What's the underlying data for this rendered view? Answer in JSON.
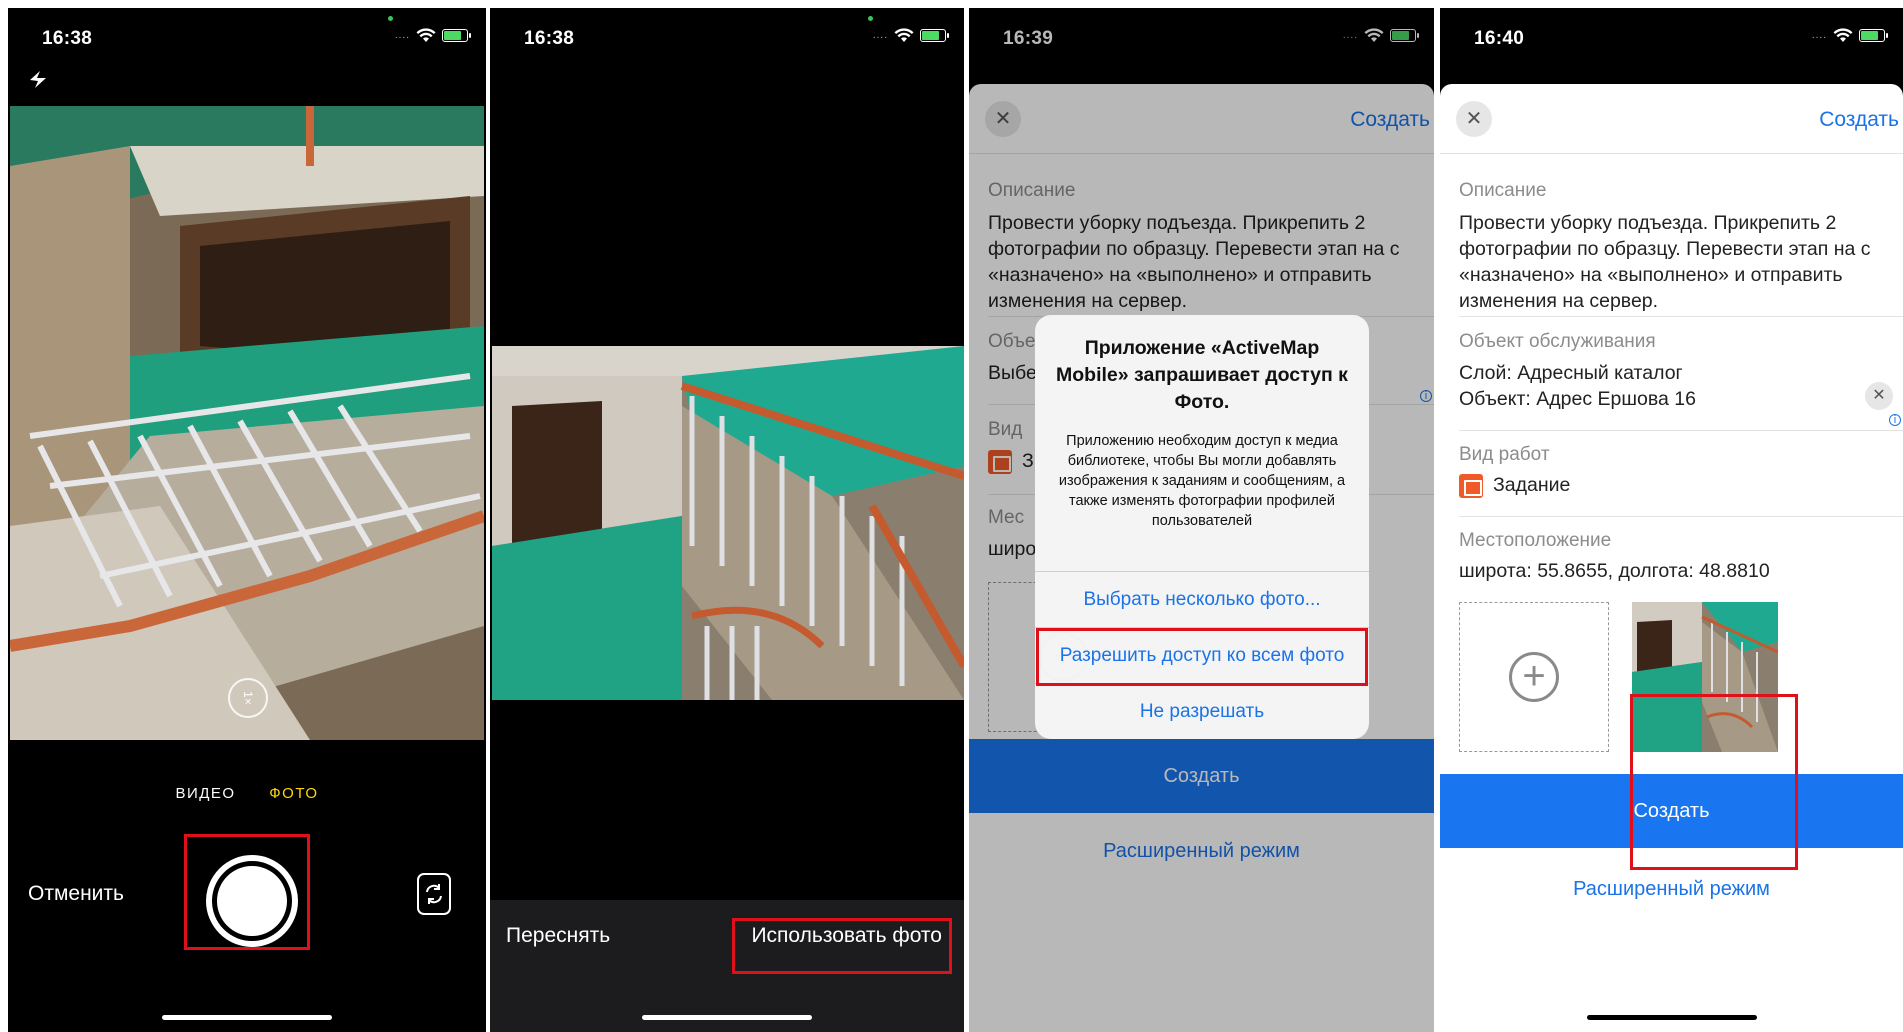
{
  "p1": {
    "time": "16:38",
    "modes": [
      "ВИДЕО",
      "ФОТО"
    ],
    "cancel": "Отменить",
    "zoom": "1×",
    "icons": [
      "flash-icon",
      "zoom-icon",
      "switch-camera-icon"
    ]
  },
  "p2": {
    "time": "16:38",
    "retake": "Переснять",
    "use_photo": "Использовать фото"
  },
  "p3": {
    "time": "16:39",
    "create_top": "Создать",
    "description_label": "Описание",
    "description": "Провести уборку подъезда. Прикрепить 2 фотографии по образцу. Перевести этап на с «назначено» на «выполнено» и отправить изменения на сервер.",
    "object_label_partial": "Объе",
    "object_value_partial": "Выбе",
    "worktype_label_partial": "Вид",
    "worktype_value_partial": "З",
    "location_label_partial": "Мес",
    "location_value_partial": "широ",
    "alert": {
      "title": "Приложение «ActiveMap Mobile» запрашивает доступ к Фото.",
      "message": "Приложению необходим доступ к медиа библиотеке, чтобы Вы могли добавлять изображения к заданиям и сообщениям, а также изменять фотографии профилей пользователей",
      "btn_select": "Выбрать несколько фото...",
      "btn_allow_all": "Разрешить доступ ко всем фото",
      "btn_deny": "Не разрешать"
    },
    "create_button": "Создать",
    "advanced": "Расширенный режим"
  },
  "p4": {
    "time": "16:40",
    "create_top": "Создать",
    "description_label": "Описание",
    "description": "Провести уборку подъезда. Прикрепить 2 фотографии по образцу. Перевести этап на с «назначено» на «выполнено» и отправить изменения на сервер.",
    "object_label": "Объект обслуживания",
    "object_layer": "Слой: Адресный каталог",
    "object_object": "Объект: Адрес  Ершова 16",
    "worktype_label": "Вид работ",
    "worktype_value": "Задание",
    "location_label": "Местоположение",
    "location_value": "широта: 55.8655, долгота: 48.8810",
    "create_button": "Создать",
    "advanced": "Расширенный режим"
  },
  "colors": {
    "accent_blue": "#1976f0",
    "link_blue": "#1a73e8",
    "highlight_red": "#e0101a",
    "camera_mode_active": "#ffd60a"
  }
}
